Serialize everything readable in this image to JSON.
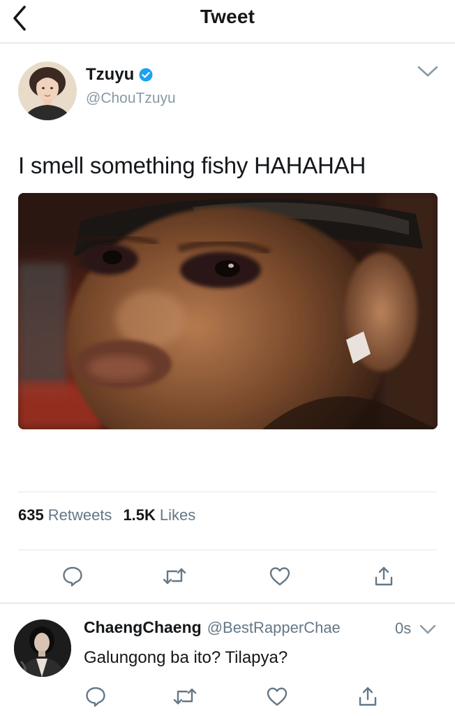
{
  "header": {
    "title": "Tweet",
    "back_icon": "chevron-left-icon"
  },
  "tweet": {
    "author_name": "Tzuyu",
    "author_handle": "@ChouTzuyu",
    "verified": true,
    "text": "I smell something fishy HAHAHAH",
    "media_description": "close-up meme photo of a man squinting sideways",
    "stats": {
      "retweets_count": "635",
      "retweets_label": "Retweets",
      "likes_count": "1.5K",
      "likes_label": "Likes"
    },
    "actions": [
      "reply-icon",
      "retweet-icon",
      "like-icon",
      "share-icon"
    ]
  },
  "reply": {
    "author_name": "ChaengChaeng",
    "author_handle": "@BestRapperChae",
    "time": "0s",
    "text": "Galungong ba ito? Tilapya?",
    "actions": [
      "reply-icon",
      "retweet-icon",
      "like-icon",
      "share-icon"
    ]
  },
  "colors": {
    "icon_gray": "#657786",
    "link_blue": "#1da1f2",
    "divider": "#e1e8ed"
  }
}
